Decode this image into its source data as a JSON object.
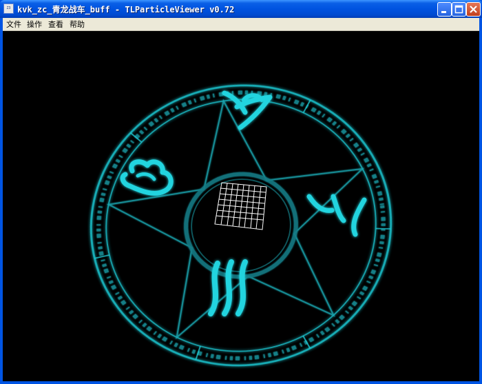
{
  "window": {
    "title": "kvk_zc_青龙战车_buff - TLParticleViewer v0.72",
    "icon": "app-icon"
  },
  "menu": {
    "items": [
      {
        "label": "文件"
      },
      {
        "label": "操作"
      },
      {
        "label": "查看"
      },
      {
        "label": "帮助"
      }
    ]
  },
  "viewport": {
    "background": "#000000",
    "glow_color": "#1fc9d4",
    "grid_color": "#ffffff"
  }
}
